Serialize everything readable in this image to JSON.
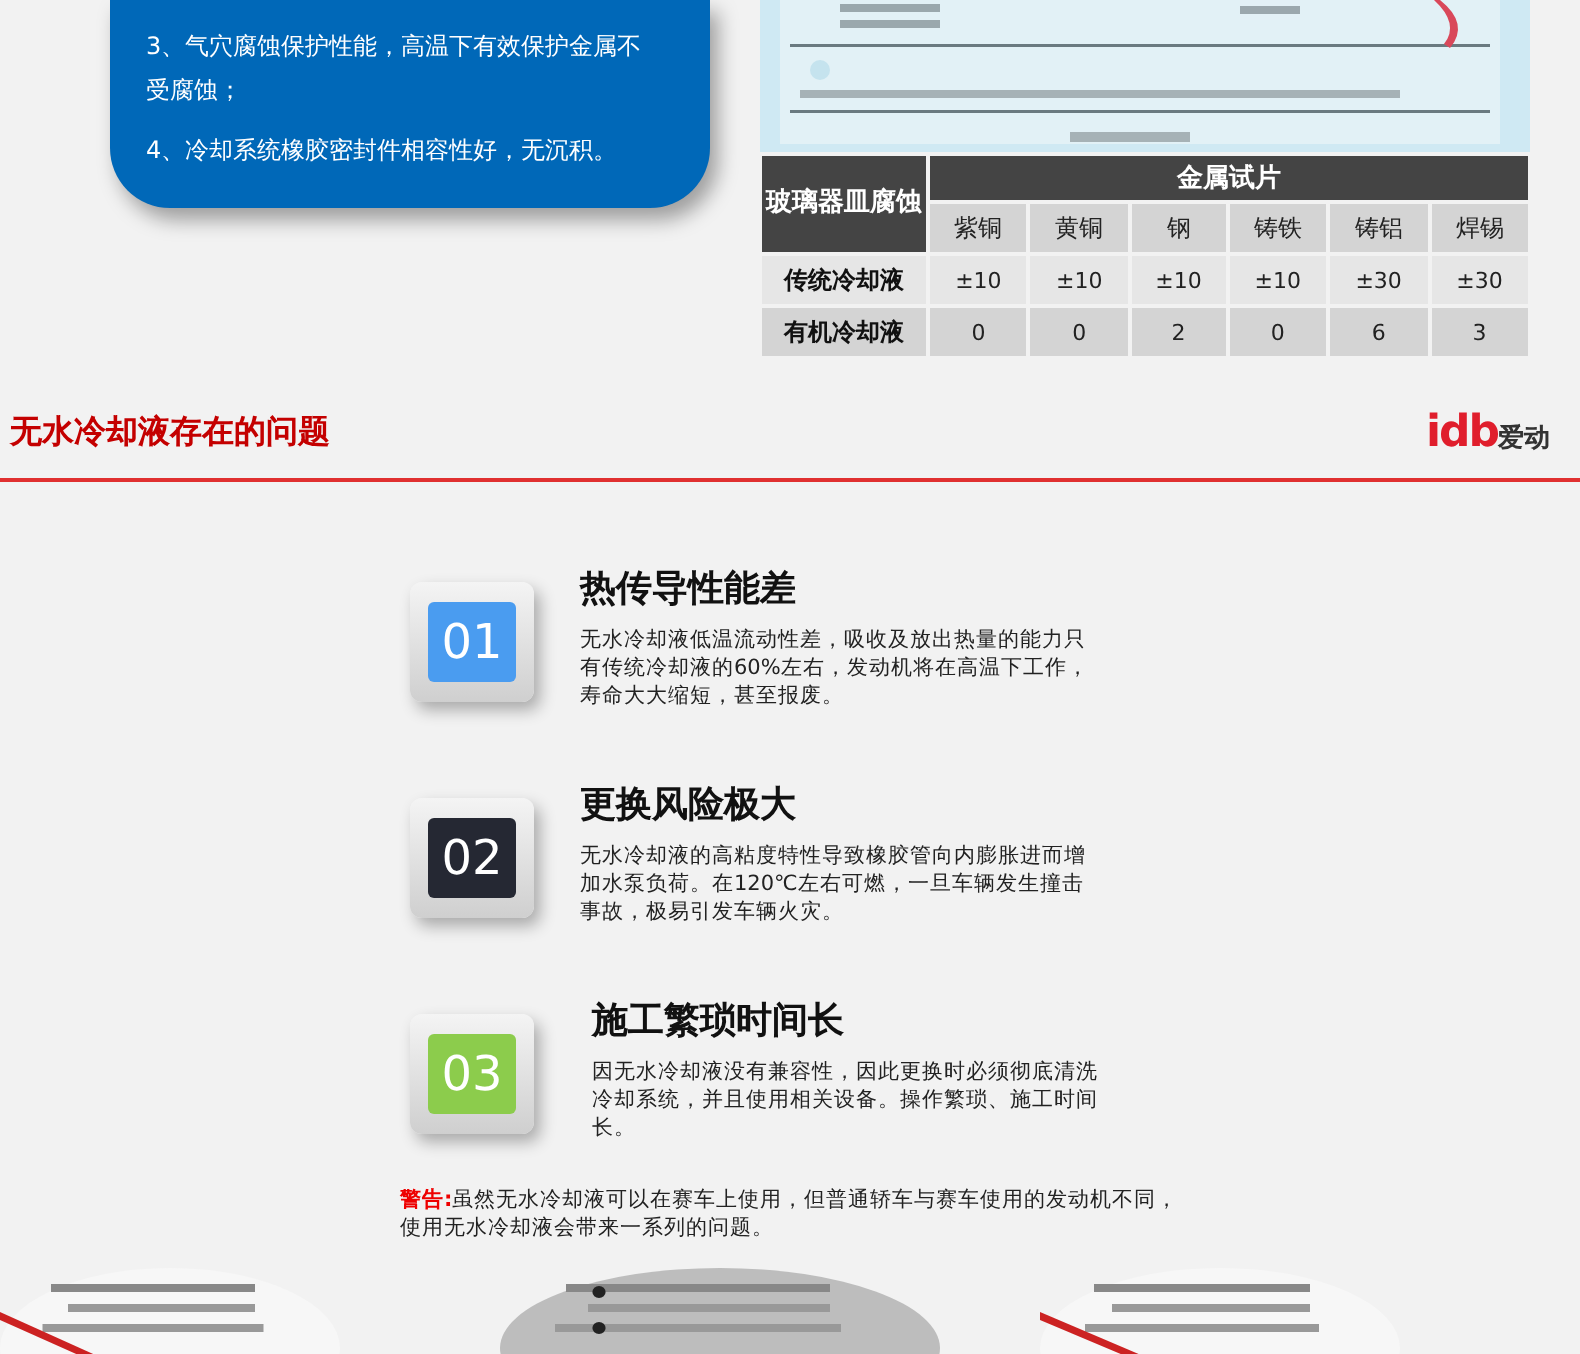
{
  "features_box": {
    "items": [
      "3、气穴腐蚀保护性能，高温下有效保护金属不受腐蚀；",
      "4、冷却系统橡胶密封件相容性好，无沉积。"
    ]
  },
  "table": {
    "corner_header": "玻璃器皿腐蚀",
    "group_header": "金属试片",
    "columns": [
      "紫铜",
      "黄铜",
      "钢",
      "铸铁",
      "铸铝",
      "焊锡"
    ],
    "rows": [
      {
        "label": "传统冷却液",
        "cells": [
          "±10",
          "±10",
          "±10",
          "±10",
          "±30",
          "±30"
        ]
      },
      {
        "label": "有机冷却液",
        "cells": [
          "0",
          "0",
          "2",
          "0",
          "6",
          "3"
        ]
      }
    ]
  },
  "section": {
    "title": "无水冷却液存在的问题",
    "logo_mark": "idb",
    "logo_text": "爱动"
  },
  "problems": [
    {
      "number": "01",
      "color": "#4a9cf0",
      "title": "热传导性能差",
      "description": "无水冷却液低温流动性差，吸收及放出热量的能力只有传统冷却液的60%左右，发动机将在高温下工作，寿命大大缩短，甚至报废。"
    },
    {
      "number": "02",
      "color": "#252833",
      "title": "更换风险极大",
      "description": "无水冷却液的高粘度特性导致橡胶管向内膨胀进而增加水泵负荷。在120℃左右可燃，一旦车辆发生撞击事故，极易引发车辆火灾。"
    },
    {
      "number": "03",
      "color": "#8ccc4c",
      "title": "施工繁琐时间长",
      "description": "因无水冷却液没有兼容性，因此更换时必须彻底清洗冷却系统，并且使用相关设备。操作繁琐、施工时间长。"
    }
  ],
  "warning": {
    "label": "警告:",
    "text": "虽然无水冷却液可以在赛车上使用，但普通轿车与赛车使用的发动机不同，使用无水冷却液会带来一系列的问题。"
  }
}
